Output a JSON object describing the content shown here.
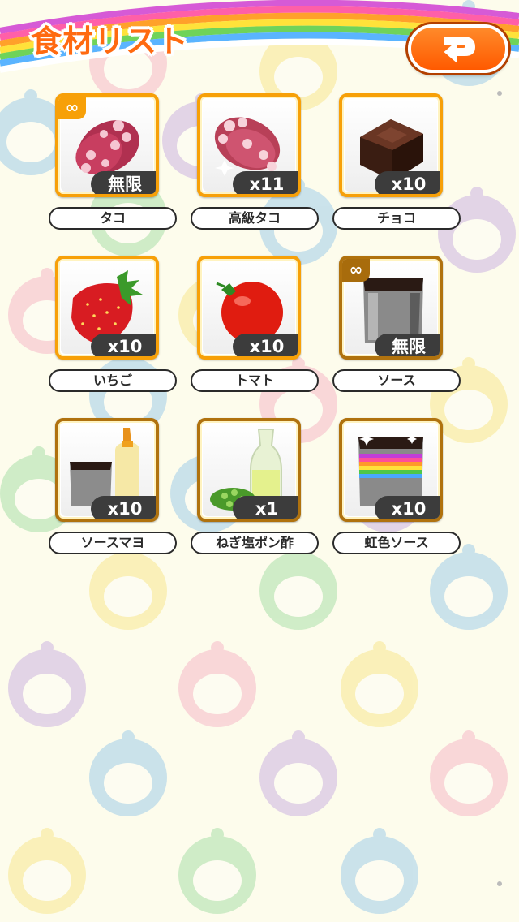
{
  "header": {
    "title": "食材リスト",
    "back_button_icon": "return-arrow-icon"
  },
  "items": [
    {
      "name": "タコ",
      "count": "無限",
      "infinite": true,
      "frame": "gold",
      "icon": "octopus-icon"
    },
    {
      "name": "高級タコ",
      "count": "x11",
      "infinite": false,
      "frame": "gold",
      "icon": "premium-octopus-icon"
    },
    {
      "name": "チョコ",
      "count": "x10",
      "infinite": false,
      "frame": "gold",
      "icon": "chocolate-icon"
    },
    {
      "name": "いちご",
      "count": "x10",
      "infinite": false,
      "frame": "gold",
      "icon": "strawberry-icon"
    },
    {
      "name": "トマト",
      "count": "x10",
      "infinite": false,
      "frame": "gold",
      "icon": "tomato-icon"
    },
    {
      "name": "ソース",
      "count": "無限",
      "infinite": true,
      "frame": "bronze",
      "icon": "sauce-can-icon"
    },
    {
      "name": "ソースマヨ",
      "count": "x10",
      "infinite": false,
      "frame": "bronze",
      "icon": "sauce-mayo-icon"
    },
    {
      "name": "ねぎ塩ポン酢",
      "count": "x1",
      "infinite": false,
      "frame": "bronze",
      "icon": "negi-shio-ponzu-icon"
    },
    {
      "name": "虹色ソース",
      "count": "x10",
      "infinite": false,
      "frame": "bronze",
      "icon": "rainbow-sauce-icon"
    }
  ],
  "infinite_symbol": "∞",
  "colors": {
    "accent": "#ff6a10",
    "gold_frame": "#f7a008",
    "bronze_frame": "#b0720e",
    "count_badge": "#3c3c3c",
    "background": "#fdfcec"
  }
}
